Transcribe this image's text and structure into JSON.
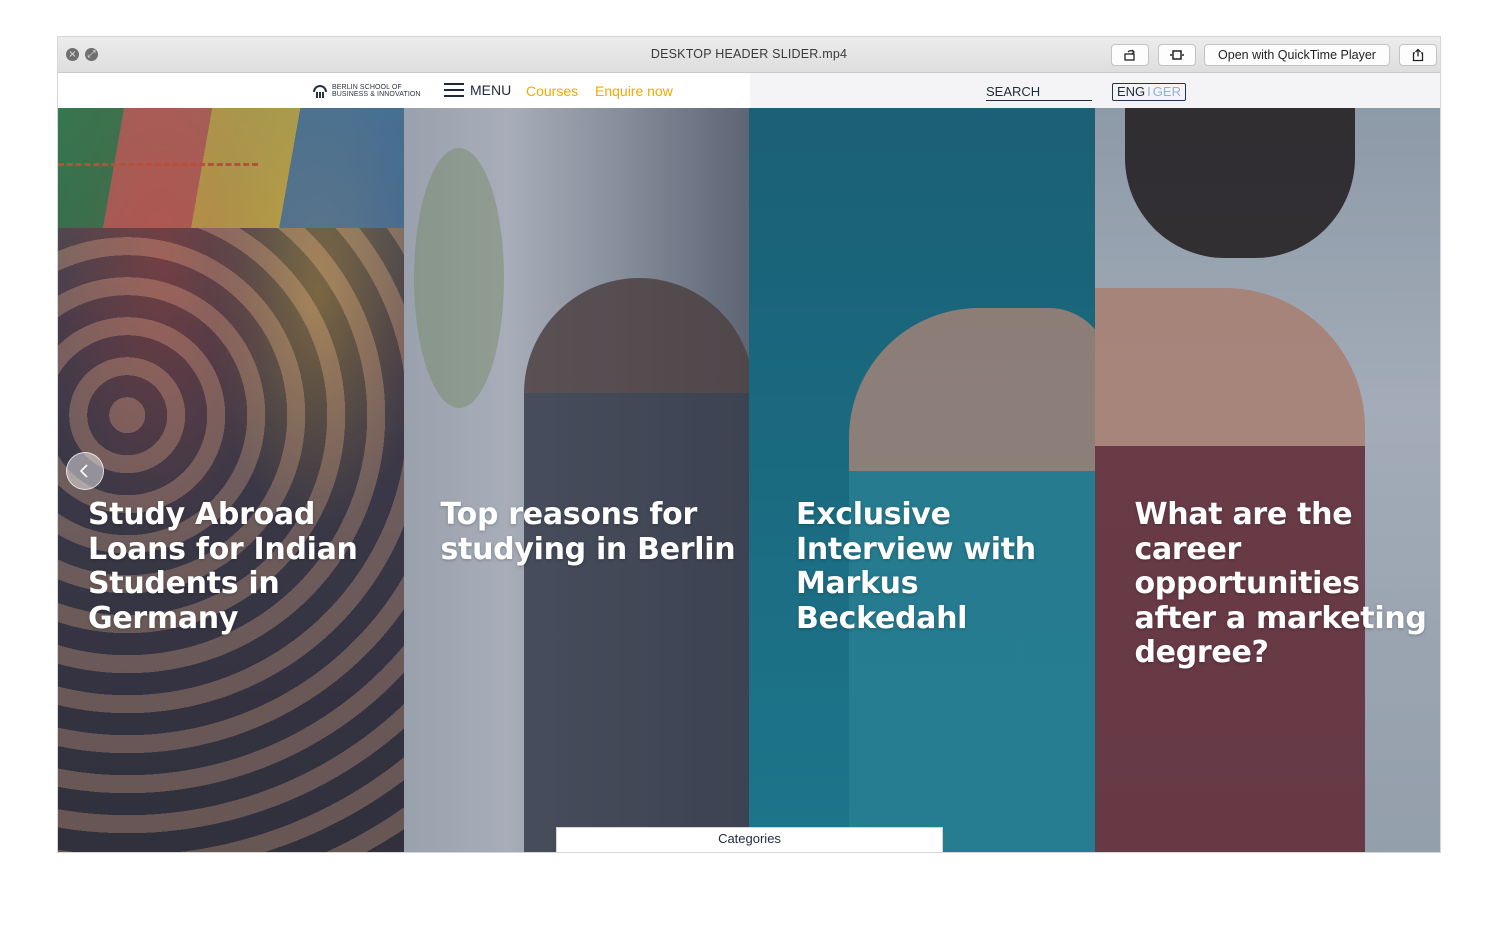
{
  "window": {
    "title": "DESKTOP HEADER SLIDER.mp4",
    "open_with_label": "Open with QuickTime Player",
    "close_icon": "close-icon",
    "fullscreen_icon": "fullscreen-icon",
    "rotate_icon": "rotate-icon",
    "trim_icon": "trim-icon",
    "share_icon": "share-icon"
  },
  "nav": {
    "logo_line1": "BERLIN SCHOOL OF",
    "logo_line2": "BUSINESS & INNOVATION",
    "menu_label": "MENU",
    "courses_label": "Courses",
    "enquire_label": "Enquire now",
    "search_label": "SEARCH",
    "lang_eng": "ENG",
    "lang_sep": "I",
    "lang_ger": "GER",
    "accent_color": "#f2a900"
  },
  "slides": [
    {
      "title": "Study Abroad Loans for Indian Students in Germany"
    },
    {
      "title": "Top reasons for studying in Berlin"
    },
    {
      "title": "Exclusive Interview with Markus Beckedahl"
    },
    {
      "title": "What are the career opportunities after a marketing degree?"
    }
  ],
  "slider": {
    "prev_icon": "chevron-left-icon",
    "categories_label": "Categories"
  }
}
